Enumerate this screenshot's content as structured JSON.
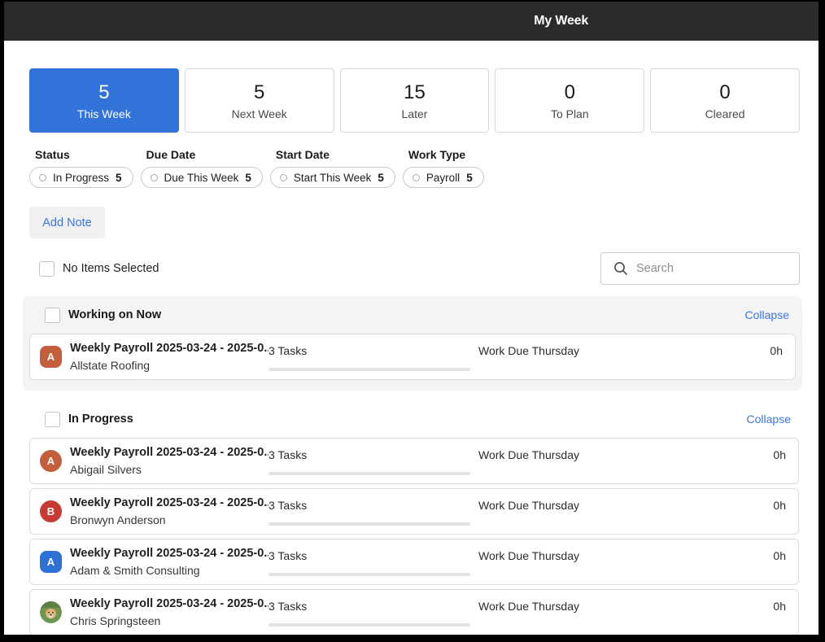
{
  "colors": {
    "accent_blue": "#3273d9",
    "link_blue": "#3b76dd",
    "header_bg": "#2b2b2b",
    "section_grey": "#f4f4f4",
    "avatar_orange": "#c45f3d",
    "avatar_red": "#c83a34",
    "avatar_blue": "#2e71d4"
  },
  "header": {
    "title": "My Week"
  },
  "tabs": [
    {
      "count": "5",
      "label": "This Week",
      "active": true
    },
    {
      "count": "5",
      "label": "Next Week",
      "active": false
    },
    {
      "count": "15",
      "label": "Later",
      "active": false
    },
    {
      "count": "0",
      "label": "To Plan",
      "active": false
    },
    {
      "count": "0",
      "label": "Cleared",
      "active": false
    }
  ],
  "filters": {
    "groups": [
      {
        "label": "Status",
        "pill_label": "In Progress",
        "pill_count": "5"
      },
      {
        "label": "Due Date",
        "pill_label": "Due This Week",
        "pill_count": "5"
      },
      {
        "label": "Start Date",
        "pill_label": "Start This Week",
        "pill_count": "5"
      },
      {
        "label": "Work Type",
        "pill_label": "Payroll",
        "pill_count": "5"
      }
    ]
  },
  "toolbar": {
    "add_note_label": "Add Note"
  },
  "selection_bar": {
    "label": "No Items Selected"
  },
  "search": {
    "placeholder": "Search",
    "icon": "search-icon"
  },
  "sections": [
    {
      "title": "Working on Now",
      "collapse_label": "Collapse",
      "items": [
        {
          "title": "Weekly Payroll 2025-03-24 - 2025-0...",
          "client": "Allstate Roofing",
          "tasks": "3 Tasks",
          "due": "Work Due Thursday",
          "hours": "0h",
          "avatar_letter": "A",
          "avatar_style": "square-orange"
        }
      ]
    },
    {
      "title": "In Progress",
      "collapse_label": "Collapse",
      "items": [
        {
          "title": "Weekly Payroll 2025-03-24 - 2025-0...",
          "client": "Abigail Silvers",
          "tasks": "3 Tasks",
          "due": "Work Due Thursday",
          "hours": "0h",
          "avatar_letter": "A",
          "avatar_style": "circle-orange"
        },
        {
          "title": "Weekly Payroll 2025-03-24 - 2025-0...",
          "client": "Bronwyn Anderson",
          "tasks": "3 Tasks",
          "due": "Work Due Thursday",
          "hours": "0h",
          "avatar_letter": "B",
          "avatar_style": "circle-red"
        },
        {
          "title": "Weekly Payroll 2025-03-24 - 2025-0...",
          "client": "Adam & Smith Consulting",
          "tasks": "3 Tasks",
          "due": "Work Due Thursday",
          "hours": "0h",
          "avatar_letter": "A",
          "avatar_style": "square-blue"
        },
        {
          "title": "Weekly Payroll 2025-03-24 - 2025-0...",
          "client": "Chris Springsteen",
          "tasks": "3 Tasks",
          "due": "Work Due Thursday",
          "hours": "0h",
          "avatar_letter": "",
          "avatar_style": "photo-dog"
        }
      ]
    }
  ]
}
